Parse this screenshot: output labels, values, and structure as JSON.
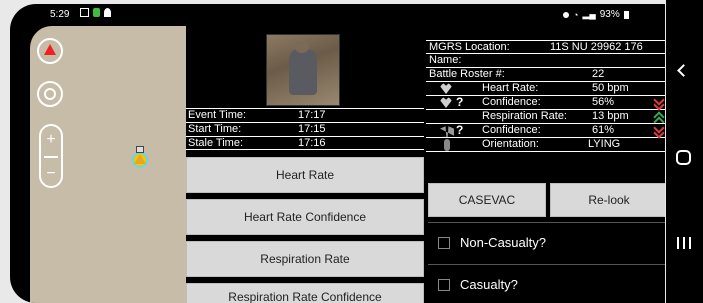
{
  "status_bar": {
    "time": "5:29",
    "battery": "93%"
  },
  "summary": {
    "event_time_label": "Event Time:",
    "event_time": "17:17",
    "start_time_label": "Start Time:",
    "start_time": "17:15",
    "stale_time_label": "Stale Time:",
    "stale_time": "17:16"
  },
  "vital_buttons": [
    "Heart Rate",
    "Heart Rate Confidence",
    "Respiration Rate",
    "Respiration Rate Confidence"
  ],
  "info": {
    "mgrs_label": "MGRS Location:",
    "mgrs_value": "11S NU 29962 176",
    "name_label": "Name:",
    "name_value": "",
    "roster_label": "Battle Roster #:",
    "roster_value": "22",
    "heart_rate_label": "Heart Rate:",
    "heart_rate_value": "50 bpm",
    "hr_conf_label": "Confidence:",
    "hr_conf_value": "56%",
    "resp_rate_label": "Respiration Rate:",
    "resp_rate_value": "13 bpm",
    "rr_conf_label": "Confidence:",
    "rr_conf_value": "61%",
    "orientation_label": "Orientation:",
    "orientation_value": "LYING",
    "question_mark": "?"
  },
  "actions": {
    "casevac": "CASEVAC",
    "relook": "Re-look"
  },
  "checks": {
    "non_casualty": "Non-Casualty?",
    "casualty": "Casualty?"
  },
  "map_controls": {
    "zoom_in": "+",
    "zoom_out": "−"
  },
  "colors": {
    "alert_red": "#e23b3b",
    "ok_green": "#36a852",
    "button_bg": "#d9d9d9",
    "map_bg": "#c7bca8"
  }
}
